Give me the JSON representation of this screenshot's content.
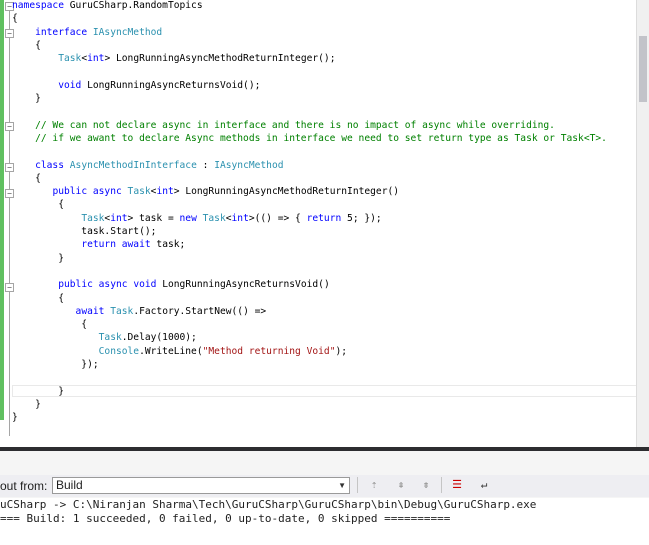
{
  "editor": {
    "lines": [
      "namespace GuruCSharp.RandomTopics",
      "{",
      "    interface IAsyncMethod",
      "    {",
      "        Task<int> LongRunningAsyncMethodReturnInteger();",
      "",
      "        void LongRunningAsyncReturnsVoid();",
      "    }",
      "",
      "    // We can not declare async in interface and there is no impact of async while overriding.",
      "    // if we awant to declare Async methods in interface we need to set return type as Task or Task<T>.",
      "",
      "    class AsyncMethodInInterface : IAsyncMethod",
      "    {",
      "       public async Task<int> LongRunningAsyncMethodReturnInteger()",
      "        {",
      "            Task<int> task = new Task<int>(() => { return 5; });",
      "            task.Start();",
      "            return await task;",
      "        }",
      "",
      "        public async void LongRunningAsyncReturnsVoid()",
      "        {",
      "           await Task.Factory.StartNew(() =>",
      "            {",
      "               Task.Delay(1000);",
      "               Console.WriteLine(\"Method returning Void\");",
      "            });",
      "",
      "        }",
      "    }",
      "}"
    ]
  },
  "output": {
    "show_output_from_label": "out from:",
    "source_selected": "Build",
    "lines": [
      "uCSharp -> C:\\Niranjan Sharma\\Tech\\GuruCSharp\\GuruCSharp\\bin\\Debug\\GuruCSharp.exe",
      "=== Build: 1 succeeded, 0 failed, 0 up-to-date, 0 skipped =========="
    ]
  },
  "icons": [
    "collapse-icon",
    "expand-icon",
    "dropdown-arrow-icon",
    "find-message-icon",
    "prev-message-icon",
    "next-message-icon",
    "clear-all-icon",
    "word-wrap-icon"
  ],
  "colors": {
    "keyword": "#0000ff",
    "type": "#2b91af",
    "comment": "#008000",
    "string": "#a31515",
    "change_bar": "#60c060"
  }
}
